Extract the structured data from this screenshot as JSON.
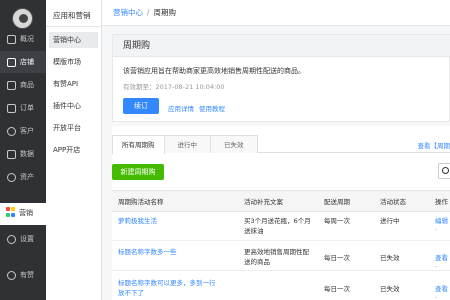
{
  "dark_nav": {
    "items": [
      {
        "label": "概况",
        "icon": "overview-icon"
      },
      {
        "label": "店铺",
        "icon": "shop-icon",
        "active": true
      },
      {
        "label": "商品",
        "icon": "goods-icon"
      },
      {
        "label": "订单",
        "icon": "orders-icon"
      },
      {
        "label": "客户",
        "icon": "customers-icon"
      },
      {
        "label": "数据",
        "icon": "data-icon"
      },
      {
        "label": "资产",
        "icon": "assets-icon"
      }
    ],
    "marketing_label": "营销",
    "settings_label": "设置",
    "youzan_label": "有赞"
  },
  "sub_nav": {
    "title": "应用和营销",
    "items": [
      "营销中心",
      "模版市场",
      "有赞API",
      "插件中心",
      "开放平台",
      "APP开店"
    ]
  },
  "breadcrumb": {
    "parent": "营销中心",
    "separator": "/",
    "current": "周期购"
  },
  "intro": {
    "title": "周期购",
    "description": "该营销应用旨在帮助商家更高效地销售周期性配送的商品。",
    "expiry": "有效期至：2017-08-21 10:04:00",
    "renew_label": "续订",
    "detail_link": "应用详情",
    "tutorial_link": "使用教程"
  },
  "tabs": [
    "所有周期购",
    "进行中",
    "已失效"
  ],
  "tab_right_link": "查看【周期",
  "new_button": "新建周期购",
  "table": {
    "headers": [
      "周期购活动名称",
      "活动补充文案",
      "配送周期",
      "活动状态",
      "操作"
    ],
    "rows": [
      {
        "name": "萝莉极我生活",
        "desc": [
          "买3个月送花瓶，6个月",
          "送抹油"
        ],
        "period": "每周一次",
        "status": "进行中",
        "op": "编辑 ·"
      },
      {
        "name": "标题名称字数多一些",
        "desc": [
          "更高效地销售周期性配",
          "送的商品"
        ],
        "period": "每日一次",
        "status": "已失效",
        "op": "查看 ·"
      },
      {
        "name": "标题名称字数可以更多，多到一行",
        "name2": "放不下了",
        "desc": [
          "",
          ""
        ],
        "period": "每日一次",
        "status": "已失效",
        "op": "查看 ·"
      }
    ]
  },
  "colors": {
    "primary": "#3388ff",
    "success": "#44bb00",
    "sidebar": "#2f3135"
  }
}
